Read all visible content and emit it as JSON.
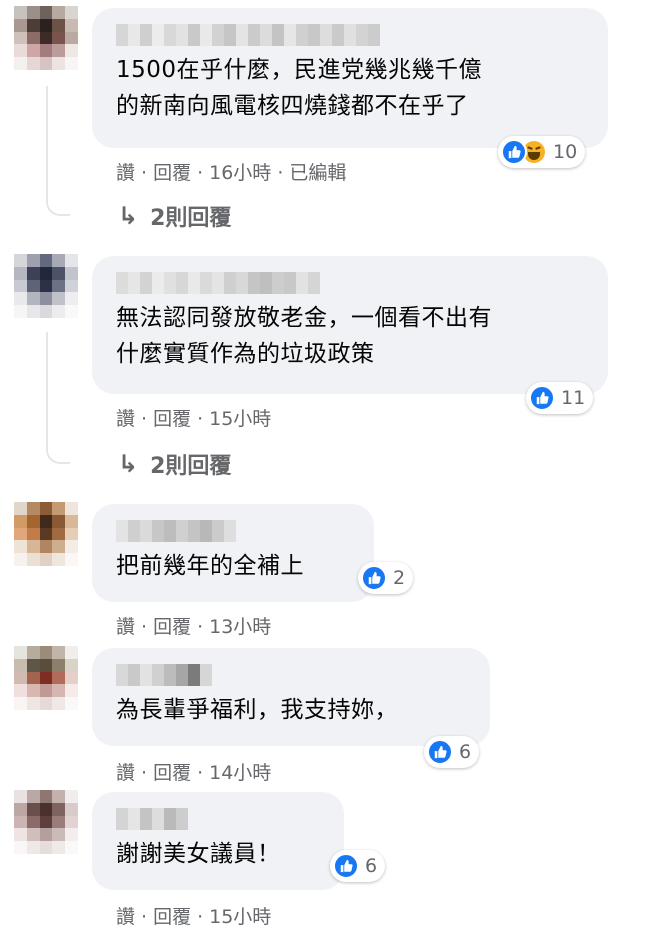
{
  "colors": {
    "like_blue": "#1877f2",
    "bubble_bg": "#f0f2f5",
    "meta_gray": "#65676b"
  },
  "comments": [
    {
      "text_lines": [
        "1500在乎什麼，民進党幾兆幾千億",
        "的新南向風電核四燒錢都不在乎了"
      ],
      "reactions": [
        "like-icon",
        "haha-icon"
      ],
      "reaction_count": "10",
      "actions": {
        "like": "讚",
        "reply": "回覆",
        "time": "16小時",
        "edited": "已編輯"
      },
      "replies_label": "2則回覆"
    },
    {
      "text_lines": [
        "無法認同發放敬老金，一個看不出有",
        "什麼實質作為的垃圾政策"
      ],
      "reactions": [
        "like-icon"
      ],
      "reaction_count": "11",
      "actions": {
        "like": "讚",
        "reply": "回覆",
        "time": "15小時"
      },
      "replies_label": "2則回覆"
    },
    {
      "text_lines": [
        "把前幾年的全補上"
      ],
      "reactions": [
        "like-icon"
      ],
      "reaction_count": "2",
      "actions": {
        "like": "讚",
        "reply": "回覆",
        "time": "13小時"
      }
    },
    {
      "text_lines": [
        "為長輩爭福利，我支持妳，"
      ],
      "reactions": [
        "like-icon"
      ],
      "reaction_count": "6",
      "actions": {
        "like": "讚",
        "reply": "回覆",
        "time": "14小時"
      }
    },
    {
      "text_lines": [
        "謝謝美女議員！"
      ],
      "reactions": [
        "like-icon"
      ],
      "reaction_count": "6",
      "actions": {
        "like": "讚",
        "reply": "回覆",
        "time": "15小時"
      }
    }
  ]
}
